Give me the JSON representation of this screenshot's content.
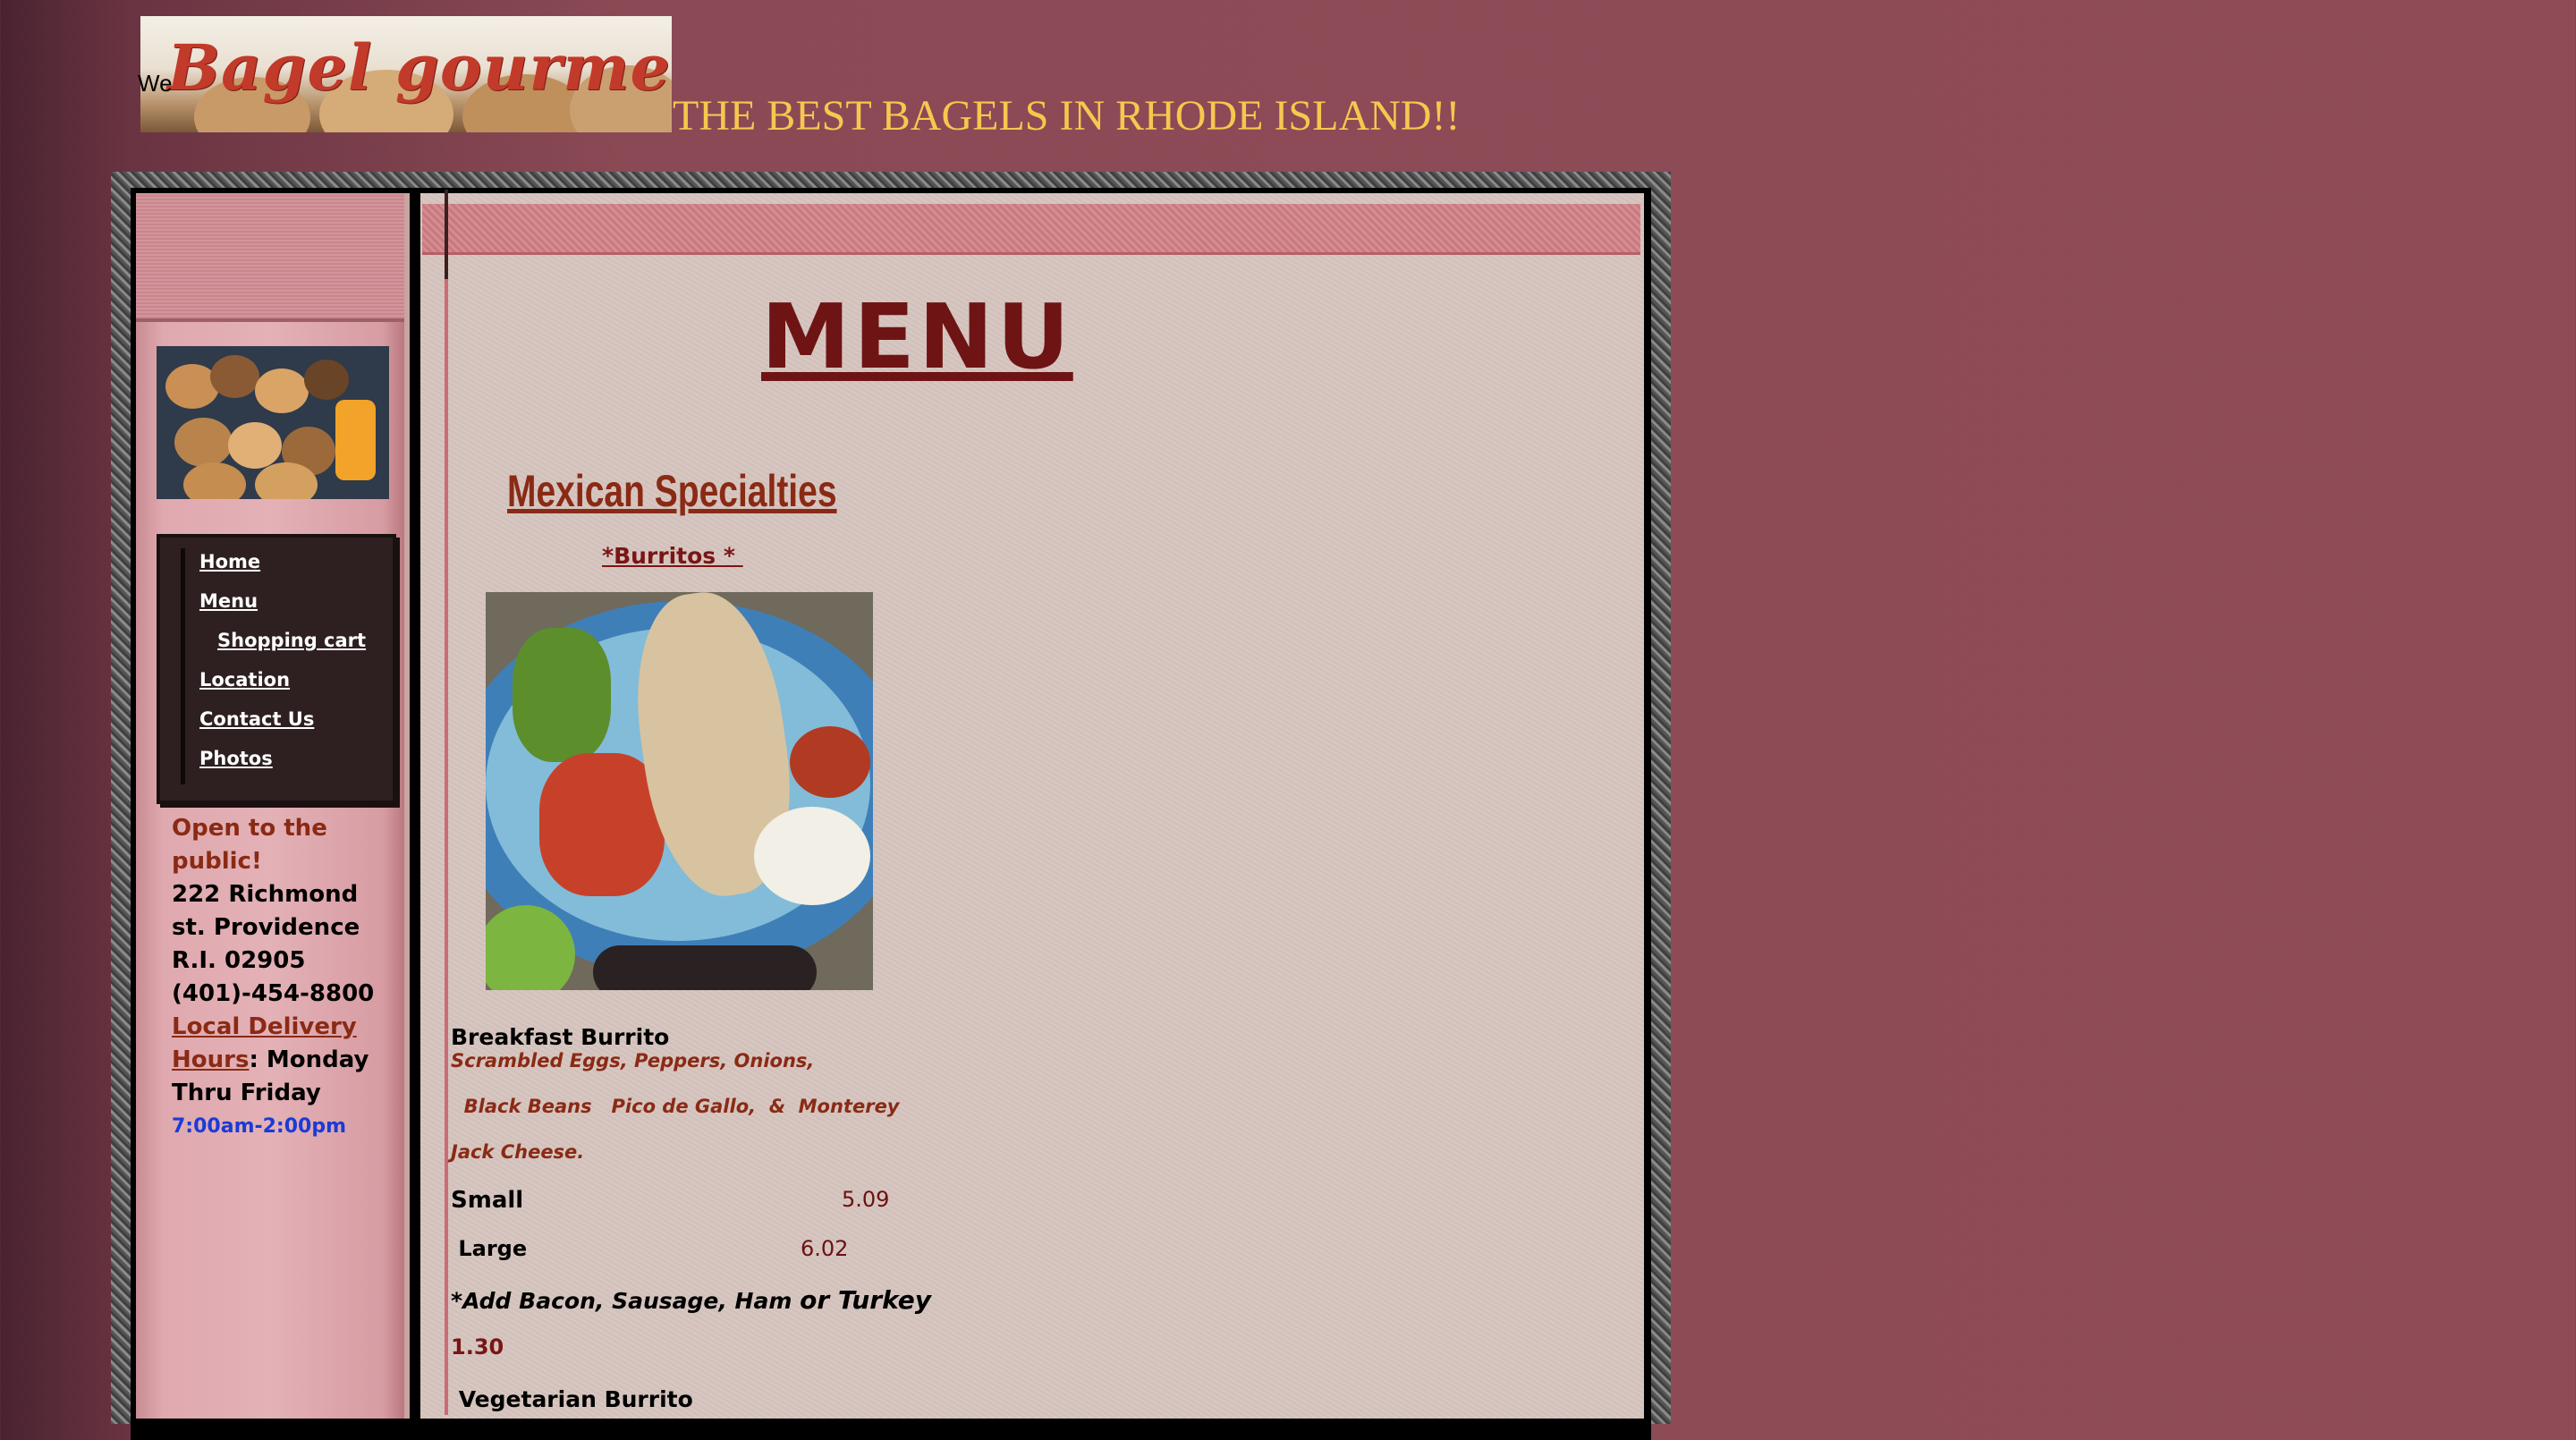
{
  "header": {
    "logo_text": "Bagel gourmet cafe",
    "welcome_fragment": "We",
    "tagline": "THE BEST BAGELS IN RHODE ISLAND!!"
  },
  "nav": {
    "items": [
      {
        "label": "Home"
      },
      {
        "label": "Menu"
      },
      {
        "label": "Shopping cart"
      },
      {
        "label": "Location"
      },
      {
        "label": "Contact Us"
      },
      {
        "label": "Photos"
      }
    ]
  },
  "sidebar_info": {
    "open_text": "Open to the public!",
    "address_line1": "222 Richmond st. Providence R.I. 02905",
    "phone": "(401)-454-8800",
    "delivery_label": "Local Delivery Hours",
    "delivery_days": ": Monday Thru Friday",
    "hours": "7:00am-2:00pm"
  },
  "main": {
    "title": "MENU",
    "section_title": "Mexican Specialties",
    "subsection": "*Burritos * ",
    "items": [
      {
        "name": "Breakfast Burrito",
        "desc_lines": [
          "Scrambled Eggs, Peppers, Onions,",
          "  Black Beans   Pico de Gallo,  &  Monterey",
          "Jack Cheese."
        ],
        "sizes": [
          {
            "label": "Small",
            "price": "5.09"
          },
          {
            "label": " Large",
            "price": "6.02"
          }
        ],
        "addon_prefix": "*",
        "addon": "Add Bacon, Sausage, Ham ",
        "addon_suffix": "or Turkey",
        "addon_price": "1.30"
      },
      {
        "name": " Vegetarian Burrito"
      }
    ]
  },
  "colors": {
    "background": "#8f4c57",
    "tagline": "#f7c74e",
    "accent_dark_red": "#6e1414",
    "accent_rust": "#8a2a15",
    "hours_blue": "#1a3bd6"
  }
}
